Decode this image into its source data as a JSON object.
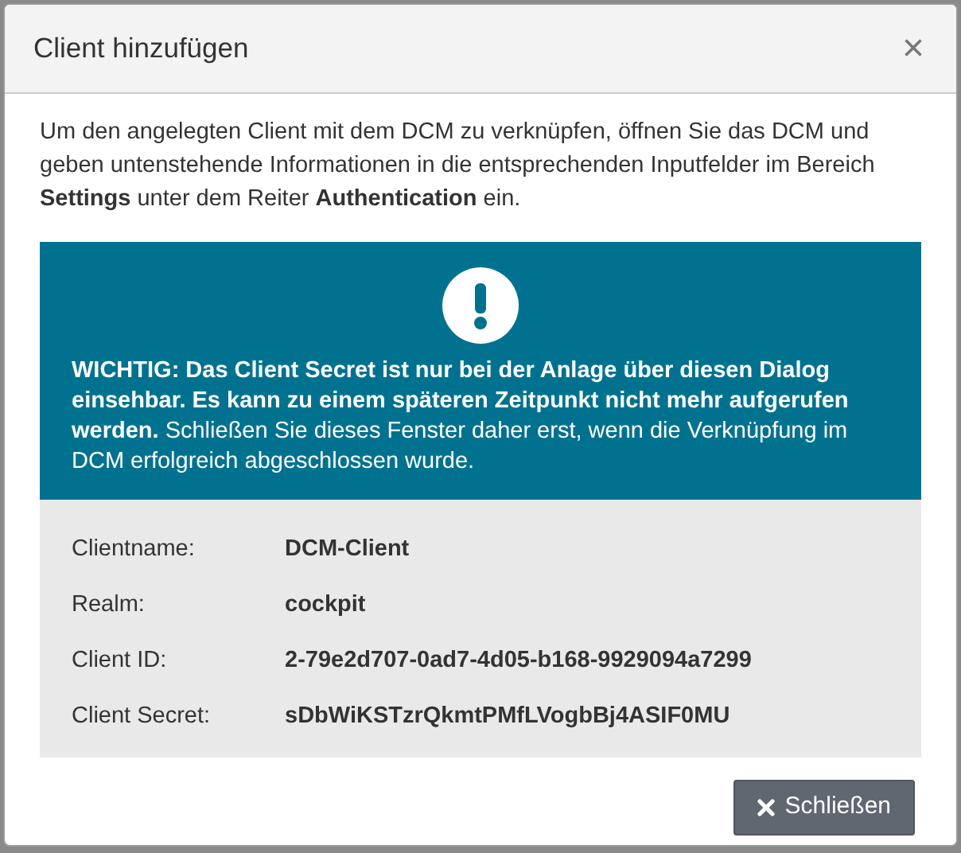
{
  "dialog": {
    "title": "Client hinzufügen",
    "close_symbol": "×",
    "intro": "Um den angelegten Client mit dem DCM zu verknüpfen, öffnen Sie das DCM und geben untenstehende Informationen in die entsprechenden Inputfelder im Bereich **Settings** unter dem Reiter **Authentication** ein.",
    "warning": "**WICHTIG: Das Client Secret ist nur bei der Anlage über diesen Dialog einsehbar. Es kann zu einem späteren Zeitpunkt nicht mehr aufgerufen werden.** Schließen Sie dieses Fenster daher erst, wenn die Verknüpfung im DCM erfolgreich abgeschlossen wurde.",
    "details": [
      {
        "label": "Clientname:",
        "value": "DCM-Client"
      },
      {
        "label": "Realm:",
        "value": "cockpit"
      },
      {
        "label": "Client ID:",
        "value": "2-79e2d707-0ad7-4d05-b168-9929094a7299"
      },
      {
        "label": "Client Secret:",
        "value": "sDbWiKSTzrQkmtPMfLVogbBj4ASIF0MU"
      }
    ],
    "buttons": [
      {
        "label": "Schließen"
      }
    ]
  }
}
